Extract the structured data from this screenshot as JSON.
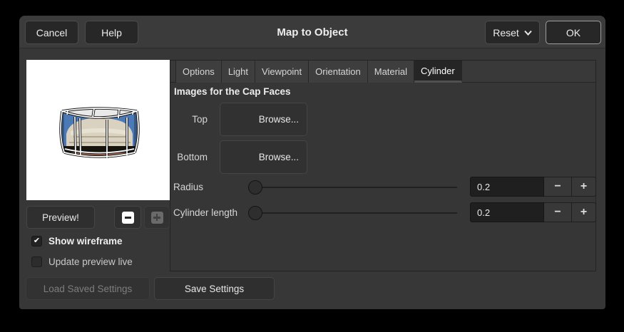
{
  "titlebar": {
    "cancel": "Cancel",
    "help": "Help",
    "title": "Map to Object",
    "reset": "Reset",
    "ok": "OK"
  },
  "tabs": {
    "items": [
      "Options",
      "Light",
      "Viewpoint",
      "Orientation",
      "Material",
      "Cylinder"
    ],
    "active": "Cylinder"
  },
  "panel": {
    "heading": "Images for the Cap Faces",
    "rows": [
      {
        "label": "Top",
        "button": "Browse..."
      },
      {
        "label": "Bottom",
        "button": "Browse..."
      }
    ],
    "sliders": [
      {
        "label": "Radius",
        "value": "0.2"
      },
      {
        "label": "Cylinder length",
        "value": "0.2"
      }
    ],
    "spinner": {
      "decrement": "−",
      "increment": "+"
    }
  },
  "preview": {
    "button": "Preview!",
    "checkmark": "✔",
    "checkboxes": [
      {
        "label": "Show wireframe",
        "checked": true
      },
      {
        "label": "Update preview live",
        "checked": false
      }
    ],
    "icons": {
      "zoom_out": "zoom-out-icon",
      "zoom_in": "zoom-in-icon"
    }
  },
  "footer": {
    "load": "Load Saved Settings",
    "save": "Save Settings"
  },
  "colors": {
    "window_bg": "#373737",
    "titlebar_bg": "#3b3b3b",
    "tab_active_bg": "#252525",
    "entry_bg": "#1f1f1f",
    "preview_bg": "#ffffff",
    "sky": "#4c7ab6",
    "building": "#d9d2c1",
    "ground": "#7c4b3c"
  }
}
